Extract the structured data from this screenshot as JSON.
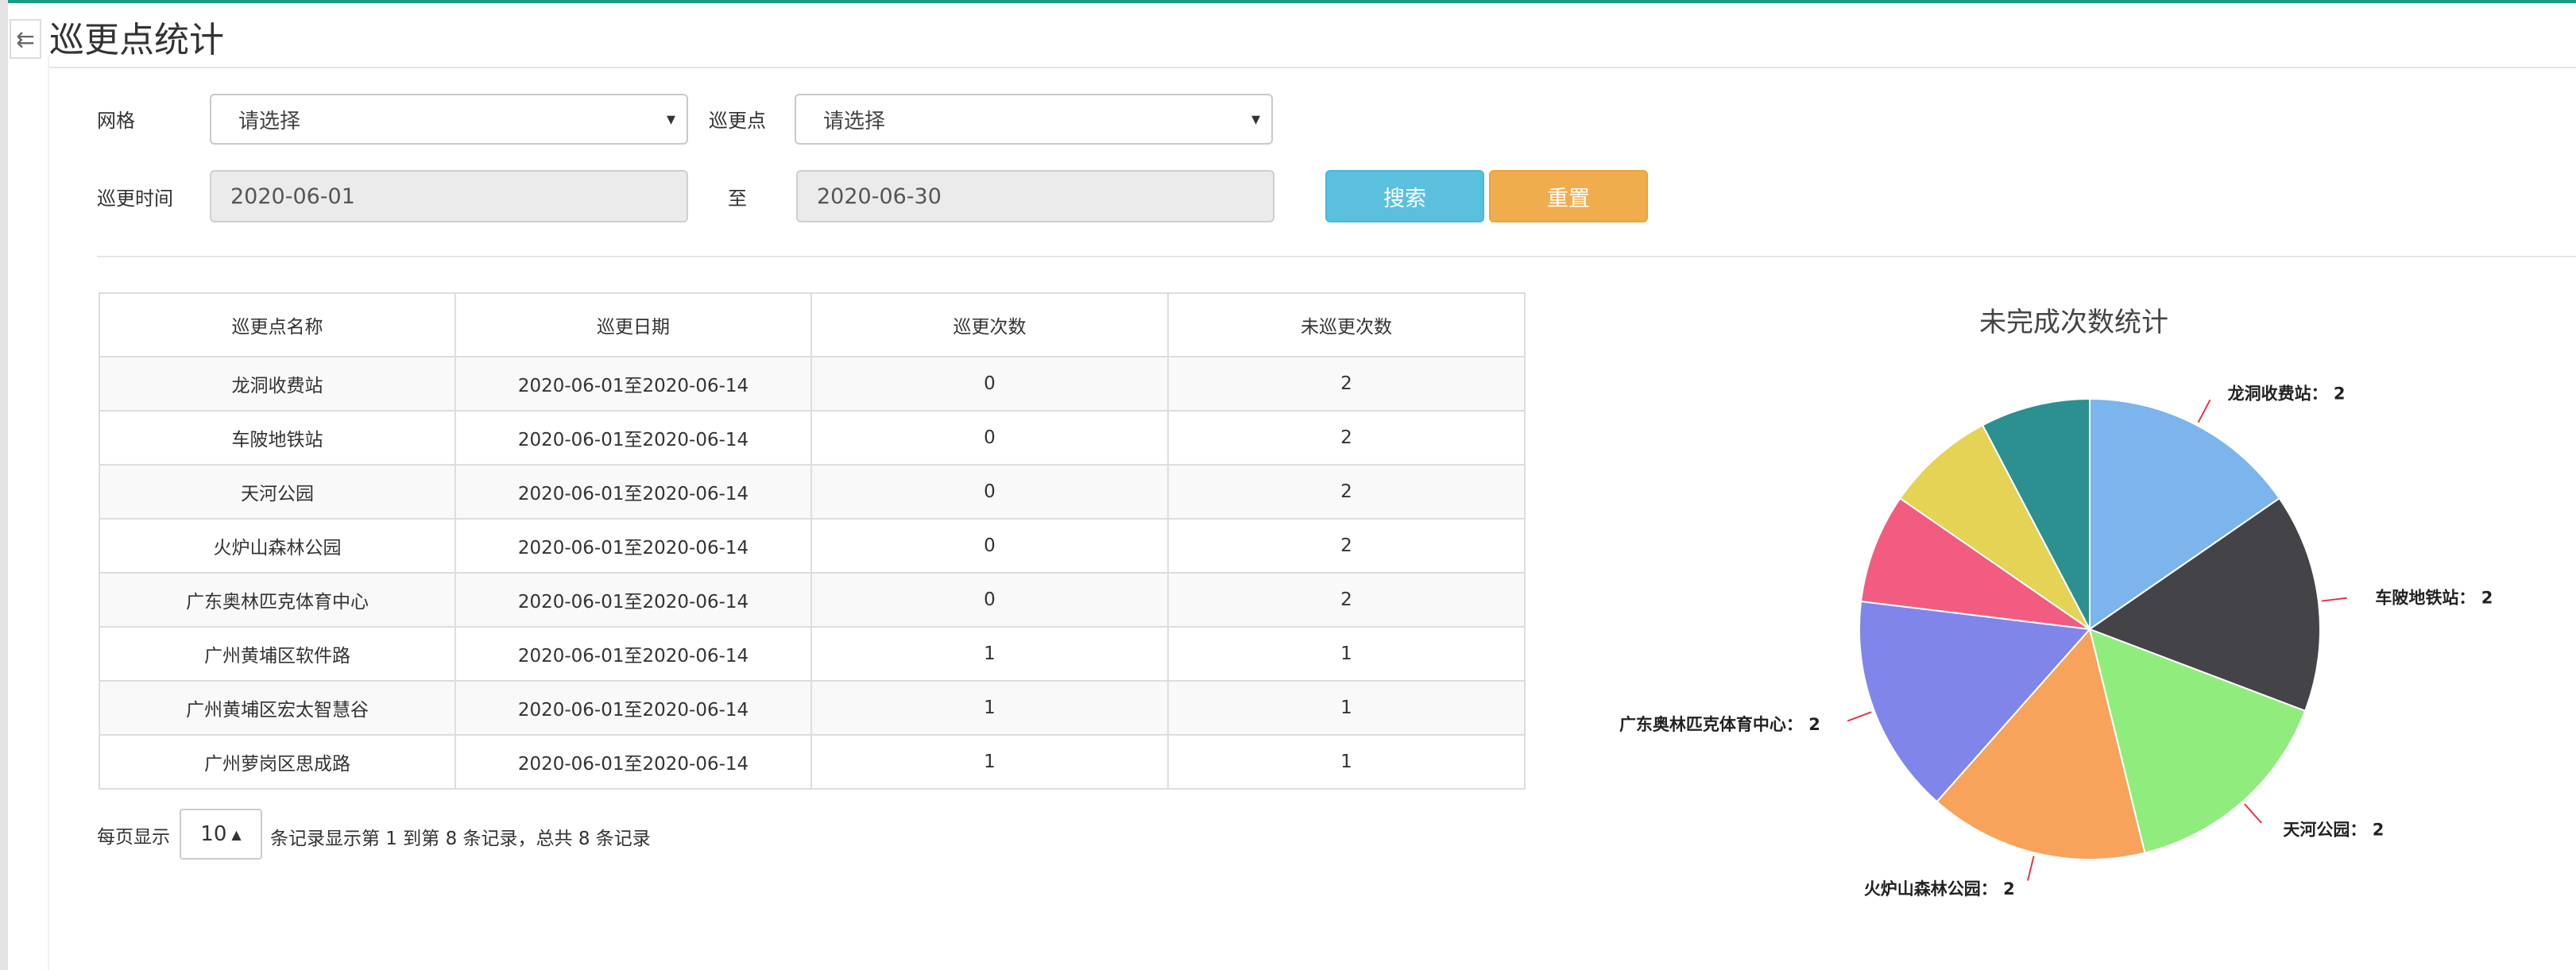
{
  "page": {
    "title": "巡更点统计",
    "toggle_icon": "collapse-menu-icon"
  },
  "filters": {
    "grid_label": "网格",
    "grid_value": "请选择",
    "point_label": "巡更点",
    "point_value": "请选择",
    "time_label": "巡更时间",
    "date_from": "2020-06-01",
    "to_label": "至",
    "date_to": "2020-06-30",
    "search_label": "搜索",
    "reset_label": "重置"
  },
  "table": {
    "headers": [
      "巡更点名称",
      "巡更日期",
      "巡更次数",
      "未巡更次数"
    ],
    "rows": [
      [
        "龙洞收费站",
        "2020-06-01至2020-06-14",
        "0",
        "2"
      ],
      [
        "车陂地铁站",
        "2020-06-01至2020-06-14",
        "0",
        "2"
      ],
      [
        "天河公园",
        "2020-06-01至2020-06-14",
        "0",
        "2"
      ],
      [
        "火炉山森林公园",
        "2020-06-01至2020-06-14",
        "0",
        "2"
      ],
      [
        "广东奥林匹克体育中心",
        "2020-06-01至2020-06-14",
        "0",
        "2"
      ],
      [
        "广州黄埔区软件路",
        "2020-06-01至2020-06-14",
        "1",
        "1"
      ],
      [
        "广州黄埔区宏太智慧谷",
        "2020-06-01至2020-06-14",
        "1",
        "1"
      ],
      [
        "广州萝岗区思成路",
        "2020-06-01至2020-06-14",
        "1",
        "1"
      ]
    ]
  },
  "pagination": {
    "per_page_label": "每页显示",
    "per_page_value": "10",
    "summary": "条记录显示第 1 到第 8 条记录，总共 8 条记录"
  },
  "chart_data": {
    "type": "pie",
    "title": "未完成次数统计",
    "slices": [
      {
        "name": "龙洞收费站",
        "value": 2,
        "color": "#7cb5ec",
        "label": "龙洞收费站： 2"
      },
      {
        "name": "车陂地铁站",
        "value": 2,
        "color": "#434348",
        "label": "车陂地铁站： 2"
      },
      {
        "name": "天河公园",
        "value": 2,
        "color": "#90ed7d",
        "label": "天河公园： 2"
      },
      {
        "name": "火炉山森林公园",
        "value": 2,
        "color": "#f7a35c",
        "label": "火炉山森林公园： 2"
      },
      {
        "name": "广东奥林匹克体育中心",
        "value": 2,
        "color": "#8085e9",
        "label": "广东奥林匹克体育中心： 2"
      },
      {
        "name": "广州黄埔区软件路",
        "value": 1,
        "color": "#f15c80",
        "label": ""
      },
      {
        "name": "广州黄埔区宏太智慧谷",
        "value": 1,
        "color": "#e4d354",
        "label": ""
      },
      {
        "name": "广州萝岗区思成路",
        "value": 1,
        "color": "#2b908f",
        "label": ""
      }
    ],
    "connector_color": "#e8334a"
  }
}
